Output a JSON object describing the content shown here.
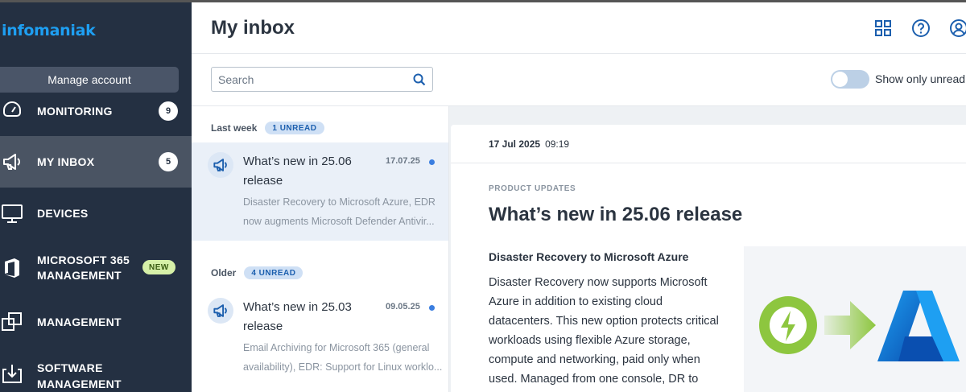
{
  "brand": {
    "logo_text": "infomaniak",
    "accent": "#1e9ff2"
  },
  "sidebar": {
    "manage_button": "Manage account",
    "items": [
      {
        "label": "MONITORING",
        "icon": "gauge-icon",
        "badge": "9"
      },
      {
        "label": "MY INBOX",
        "icon": "megaphone-icon",
        "badge": "5",
        "active": true
      },
      {
        "label": "DEVICES",
        "icon": "monitor-icon"
      },
      {
        "label": "MICROSOFT 365",
        "label2": "MANAGEMENT",
        "icon": "office-icon",
        "tag": "NEW"
      },
      {
        "label": "MANAGEMENT",
        "icon": "windows-icon"
      },
      {
        "label": "SOFTWARE",
        "label2": "MANAGEMENT",
        "icon": "download-box-icon"
      }
    ]
  },
  "header": {
    "title": "My inbox",
    "icons": [
      "apps-grid-icon",
      "help-icon",
      "user-icon"
    ]
  },
  "toolbar": {
    "search_placeholder": "Search",
    "toggle_label": "Show only unread",
    "toggle_on": false
  },
  "list": {
    "groups": [
      {
        "title": "Last week",
        "unread": "1 UNREAD",
        "messages": [
          {
            "title_line1": "What’s new in 25.06",
            "title_line2": "release",
            "date": "17.07.25",
            "preview_line1": "Disaster Recovery to Microsoft Azure, EDR",
            "preview_line2": "now augments Microsoft Defender Antivir..."
          }
        ]
      },
      {
        "title": "Older",
        "unread": "4 UNREAD",
        "messages": [
          {
            "title_line1": "What’s new in 25.03",
            "title_line2": "release",
            "date": "09.05.25",
            "preview_line1": "Email Archiving for Microsoft 365 (general",
            "preview_line2": "availability), EDR: Support for Linux worklo..."
          }
        ]
      }
    ]
  },
  "detail": {
    "date": "17 Jul 2025",
    "time": "09:19",
    "category": "PRODUCT UPDATES",
    "title": "What’s new in 25.06 release",
    "subheading": "Disaster Recovery to Microsoft Azure",
    "body_lines": [
      "Disaster Recovery now supports Microsoft",
      "Azure in addition to existing cloud",
      "datacenters. This new option protects critical",
      "workloads using flexible Azure storage,",
      "compute and networking, paid only when",
      "used. Managed from one console, DR to"
    ],
    "hero_icons": [
      "lightning-icon",
      "arrow-right-icon",
      "azure-logo-icon"
    ]
  }
}
